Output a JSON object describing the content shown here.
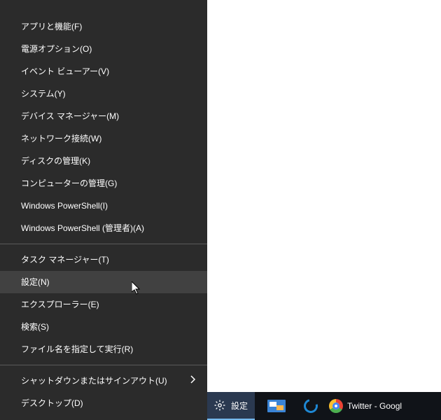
{
  "menu": {
    "items": [
      {
        "label": "アプリと機能(F)"
      },
      {
        "label": "電源オプション(O)"
      },
      {
        "label": "イベント ビューアー(V)"
      },
      {
        "label": "システム(Y)"
      },
      {
        "label": "デバイス マネージャー(M)"
      },
      {
        "label": "ネットワーク接続(W)"
      },
      {
        "label": "ディスクの管理(K)"
      },
      {
        "label": "コンピューターの管理(G)"
      },
      {
        "label": "Windows PowerShell(I)"
      },
      {
        "label": "Windows PowerShell (管理者)(A)"
      }
    ],
    "group2": [
      {
        "label": "タスク マネージャー(T)"
      },
      {
        "label": "設定(N)",
        "hovered": true
      },
      {
        "label": "エクスプローラー(E)"
      },
      {
        "label": "検索(S)"
      },
      {
        "label": "ファイル名を指定して実行(R)"
      }
    ],
    "group3": [
      {
        "label": "シャットダウンまたはサインアウト(U)",
        "submenu": true
      },
      {
        "label": "デスクトップ(D)"
      }
    ]
  },
  "taskbar": {
    "settings_label": "設定",
    "chrome_label": "Twitter - Googl"
  }
}
